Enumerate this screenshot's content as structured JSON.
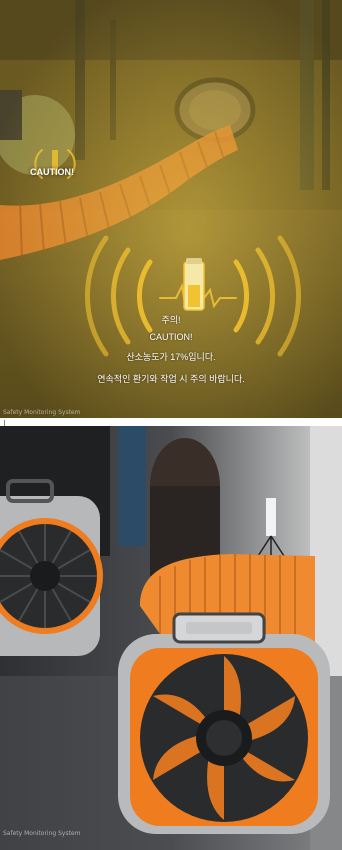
{
  "top_image": {
    "caution_label": "CAUTION!",
    "alert_line1": "주의!",
    "alert_line2": "CAUTION!",
    "alert_line3": "산소농도가 17%입니다.",
    "alert_line4": "연속적인 환기와 작업 시 주의 바랍니다.",
    "caption": "Safety Monitoring System",
    "colors": {
      "ring": "#f2c230",
      "hose": "#e8772a",
      "tint": "#d9b43a"
    }
  },
  "bottom_image": {
    "caption": "Safety Monitoring System",
    "colors": {
      "fan_accent": "#ef7d1f",
      "fan_body": "#b7b8ba",
      "fan_dark": "#2a2b2d",
      "hose": "#f08a30"
    }
  }
}
